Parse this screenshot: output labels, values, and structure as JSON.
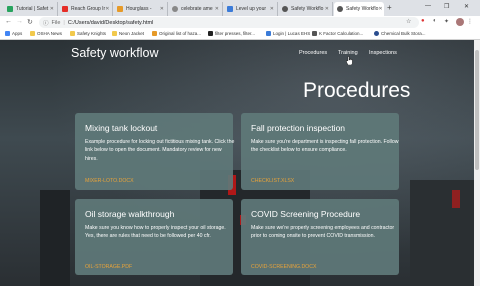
{
  "browser": {
    "tabs": [
      {
        "title": "Tutorial | Safet",
        "color": "#27a35e"
      },
      {
        "title": "Reach Group Ir",
        "color": "#e52d27"
      },
      {
        "title": "Hourglass -",
        "color": "#e69a28"
      },
      {
        "title": "celebrate ame",
        "color": "#888888"
      },
      {
        "title": "Level up your",
        "color": "#3b7bd8"
      },
      {
        "title": "Safety Workflo",
        "color": "#555555"
      },
      {
        "title": "Safety Workflo",
        "color": "#555555"
      }
    ],
    "new_tab": "+",
    "address": {
      "scheme": "File",
      "url": "C:/Users/david/Desktop/safety.html"
    },
    "bookmarks": [
      {
        "label": "Apps",
        "color": "#4285f4"
      },
      {
        "label": "OSHA News",
        "color": "#f2c94c"
      },
      {
        "label": "Safety Knights",
        "color": "#f2c94c"
      },
      {
        "label": "Neon Jacket",
        "color": "#f2c94c"
      },
      {
        "label": "Original list of haza...",
        "color": "#e69a28"
      },
      {
        "label": "filter presses, filter...",
        "color": "#222222"
      },
      {
        "label": "Login | Lucas EHS",
        "color": "#3b7bd8"
      },
      {
        "label": "K Factor Calculation...",
        "color": "#555555"
      },
      {
        "label": "Chemical Bulk Stora...",
        "color": "#2a4d8f"
      }
    ]
  },
  "site": {
    "title": "Safety workflow",
    "nav": [
      "Procedures",
      "Training",
      "Inspections"
    ],
    "heading": "Procedures"
  },
  "cards": [
    {
      "title": "Mixing tank lockout",
      "body": "Example procedure for locking out fictitious mixing tank. Click the link below to open the document. Mandatory review for new hires.",
      "link": "MIXER-LOTO.DOCX"
    },
    {
      "title": "Fall protection inspection",
      "body": "Make sure you're department is inspecting fall protection. Follow the checklist below to ensure compliance.",
      "link": "CHECKLIST.XLSX"
    },
    {
      "title": "Oil storage walkthrough",
      "body": "Make sure you know how to properly inspect your oil storage. Yes, there are rules that need to be followed per 40 cfr.",
      "link": "OIL-STORAGE.PDF"
    },
    {
      "title": "COVID Screening Procedure",
      "body": "Make sure we're properly screening employees and contractor prior to coming onsite to prevent COVID transmission.",
      "link": "COVID-SCREENING.DOCX"
    }
  ]
}
